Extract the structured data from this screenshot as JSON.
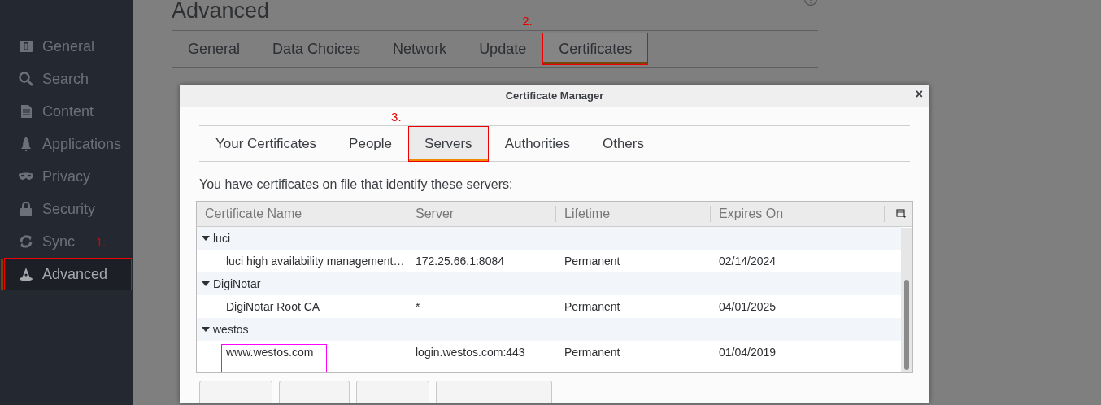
{
  "sidebar": {
    "items": [
      {
        "label": "General",
        "selected": false,
        "boxed": false
      },
      {
        "label": "Search",
        "selected": false,
        "boxed": false
      },
      {
        "label": "Content",
        "selected": false,
        "boxed": false
      },
      {
        "label": "Applications",
        "selected": false,
        "boxed": false
      },
      {
        "label": "Privacy",
        "selected": false,
        "boxed": false
      },
      {
        "label": "Security",
        "selected": false,
        "boxed": false
      },
      {
        "label": "Sync",
        "selected": false,
        "boxed": false
      },
      {
        "label": "Advanced",
        "selected": true,
        "boxed": true,
        "annotation": "1."
      }
    ]
  },
  "page": {
    "title": "Advanced",
    "tabs": [
      {
        "label": "General",
        "selected": false,
        "boxed": false
      },
      {
        "label": "Data Choices",
        "selected": false,
        "boxed": false
      },
      {
        "label": "Network",
        "selected": false,
        "boxed": false
      },
      {
        "label": "Update",
        "selected": false,
        "boxed": false
      },
      {
        "label": "Certificates",
        "selected": true,
        "boxed": true,
        "annotation": "2."
      }
    ]
  },
  "dialog": {
    "title": "Certificate Manager",
    "close": "×",
    "tabs": [
      {
        "label": "Your Certificates",
        "selected": false,
        "boxed": false
      },
      {
        "label": "People",
        "selected": false,
        "boxed": false
      },
      {
        "label": "Servers",
        "selected": true,
        "boxed": true,
        "annotation": "3."
      },
      {
        "label": "Authorities",
        "selected": false,
        "boxed": false
      },
      {
        "label": "Others",
        "selected": false,
        "boxed": false
      }
    ],
    "description": "You have certificates on file that identify these servers:",
    "tree": {
      "columns": [
        "Certificate Name",
        "Server",
        "Lifetime",
        "Expires On"
      ],
      "groups": [
        {
          "name": "luci",
          "expanded": true,
          "children": [
            {
              "cells": [
                "luci high availability management…",
                "172.25.66.1:8084",
                "Permanent",
                "02/14/2024"
              ],
              "boxed": false
            }
          ]
        },
        {
          "name": "DigiNotar",
          "expanded": true,
          "children": [
            {
              "cells": [
                "DigiNotar Root CA",
                "*",
                "Permanent",
                "04/01/2025"
              ],
              "boxed": false
            }
          ]
        },
        {
          "name": "westos",
          "expanded": true,
          "children": [
            {
              "cells": [
                "www.westos.com",
                "login.westos.com:443",
                "Permanent",
                "01/04/2019"
              ],
              "boxed": true
            }
          ]
        }
      ]
    }
  }
}
